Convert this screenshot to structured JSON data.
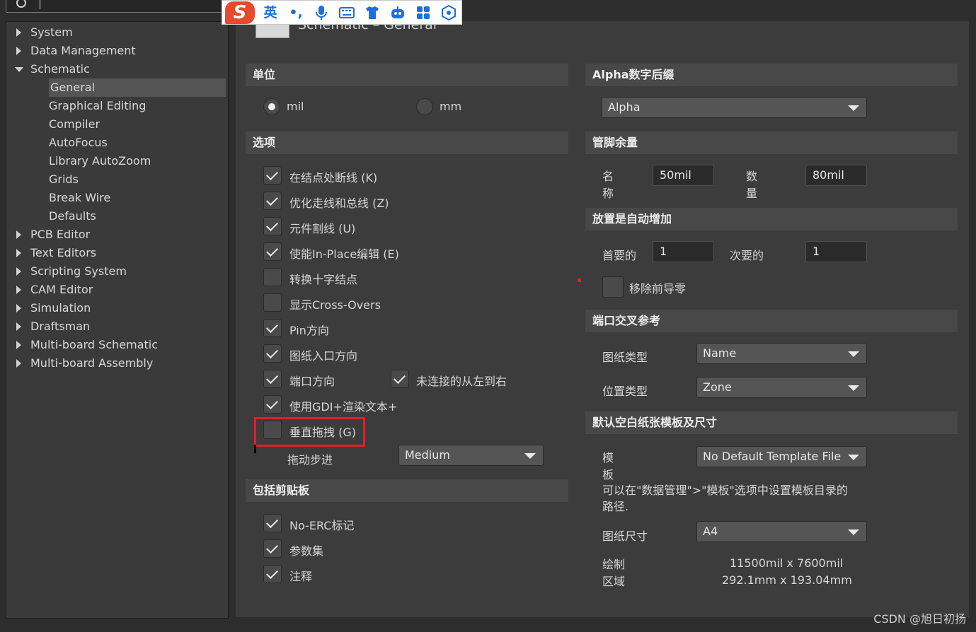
{
  "tree": {
    "items": [
      {
        "label": "System",
        "level": 0,
        "state": "collapsed"
      },
      {
        "label": "Data Management",
        "level": 0,
        "state": "collapsed"
      },
      {
        "label": "Schematic",
        "level": 0,
        "state": "expanded"
      },
      {
        "label": "General",
        "level": 1,
        "selected": true
      },
      {
        "label": "Graphical Editing",
        "level": 1
      },
      {
        "label": "Compiler",
        "level": 1
      },
      {
        "label": "AutoFocus",
        "level": 1
      },
      {
        "label": "Library AutoZoom",
        "level": 1
      },
      {
        "label": "Grids",
        "level": 1
      },
      {
        "label": "Break Wire",
        "level": 1
      },
      {
        "label": "Defaults",
        "level": 1
      },
      {
        "label": "PCB Editor",
        "level": 0,
        "state": "collapsed"
      },
      {
        "label": "Text Editors",
        "level": 0,
        "state": "collapsed"
      },
      {
        "label": "Scripting System",
        "level": 0,
        "state": "collapsed"
      },
      {
        "label": "CAM Editor",
        "level": 0,
        "state": "collapsed"
      },
      {
        "label": "Simulation",
        "level": 0,
        "state": "collapsed"
      },
      {
        "label": "Draftsman",
        "level": 0,
        "state": "collapsed"
      },
      {
        "label": "Multi-board Schematic",
        "level": 0,
        "state": "collapsed"
      },
      {
        "label": "Multi-board Assembly",
        "level": 0,
        "state": "collapsed"
      }
    ]
  },
  "page_title": "Schematic – General",
  "units": {
    "header": "单位",
    "mil": "mil",
    "mm": "mm",
    "selected": "mil"
  },
  "options": {
    "header": "选项",
    "checks": [
      {
        "label": "在结点处断线 (K)",
        "checked": true
      },
      {
        "label": "优化走线和总线 (Z)",
        "checked": true
      },
      {
        "label": "元件割线 (U)",
        "checked": true
      },
      {
        "label": "使能In-Place编辑 (E)",
        "checked": true
      },
      {
        "label": "转换十字结点",
        "checked": false
      },
      {
        "label": "显示Cross-Overs",
        "checked": false
      },
      {
        "label": "Pin方向",
        "checked": true
      },
      {
        "label": "图纸入口方向",
        "checked": true
      },
      {
        "label": "端口方向",
        "checked": true
      },
      {
        "label": "使用GDI+渲染文本+",
        "checked": true
      },
      {
        "label": "垂直拖拽 (G)",
        "checked": false
      }
    ],
    "unconnected_left_to_right": {
      "label": "未连接的从左到右",
      "checked": true
    },
    "drag_step_label": "拖动步进",
    "drag_step_value": "Medium"
  },
  "clipboard": {
    "header": "包括剪贴板",
    "checks": [
      {
        "label": "No-ERC标记",
        "checked": true
      },
      {
        "label": "参数集",
        "checked": true
      },
      {
        "label": "注释",
        "checked": true
      }
    ]
  },
  "alpha": {
    "header": "Alpha数字后缀",
    "value": "Alpha"
  },
  "pin_margin": {
    "header": "管脚余量",
    "name_label": "名称",
    "name_value": "50mil",
    "number_label": "数量",
    "number_value": "80mil"
  },
  "auto_increment": {
    "header": "放置是自动增加",
    "primary_label": "首要的",
    "primary_value": "1",
    "secondary_label": "次要的",
    "secondary_value": "1",
    "remove_leading_zeros": {
      "label": "移除前导零",
      "checked": false
    }
  },
  "port_cross_ref": {
    "header": "端口交叉参考",
    "sheet_type_label": "图纸类型",
    "sheet_type_value": "Name",
    "location_type_label": "位置类型",
    "location_type_value": "Zone"
  },
  "template": {
    "header": "默认空白纸张模板及尺寸",
    "template_label": "模板",
    "template_value": "No Default Template File",
    "hint_line1": "可以在\"数据管理\">\"模板\"选项中设置模板目录的",
    "hint_line2": "路径.",
    "sheet_size_label": "图纸尺寸",
    "sheet_size_value": "A4",
    "drawing_area_label": "绘制区域",
    "drawing_area_mil": "11500mil x 7600mil",
    "drawing_area_mm": "292.1mm x 193.04mm"
  },
  "ime_toolbar": {
    "logo": "S",
    "mode": "英",
    "punct": "•,",
    "icons": [
      "microphone-icon",
      "keyboard-icon",
      "shirt-icon",
      "robot-icon",
      "apps-grid-icon",
      "settings-hex-icon"
    ]
  },
  "watermark": "CSDN @旭日初扬",
  "colors": {
    "highlight_box": "#e0202a",
    "panel_bg": "#3c3c3c",
    "section_header_bg": "#484848",
    "tree_bg": "#3a3a3a"
  }
}
